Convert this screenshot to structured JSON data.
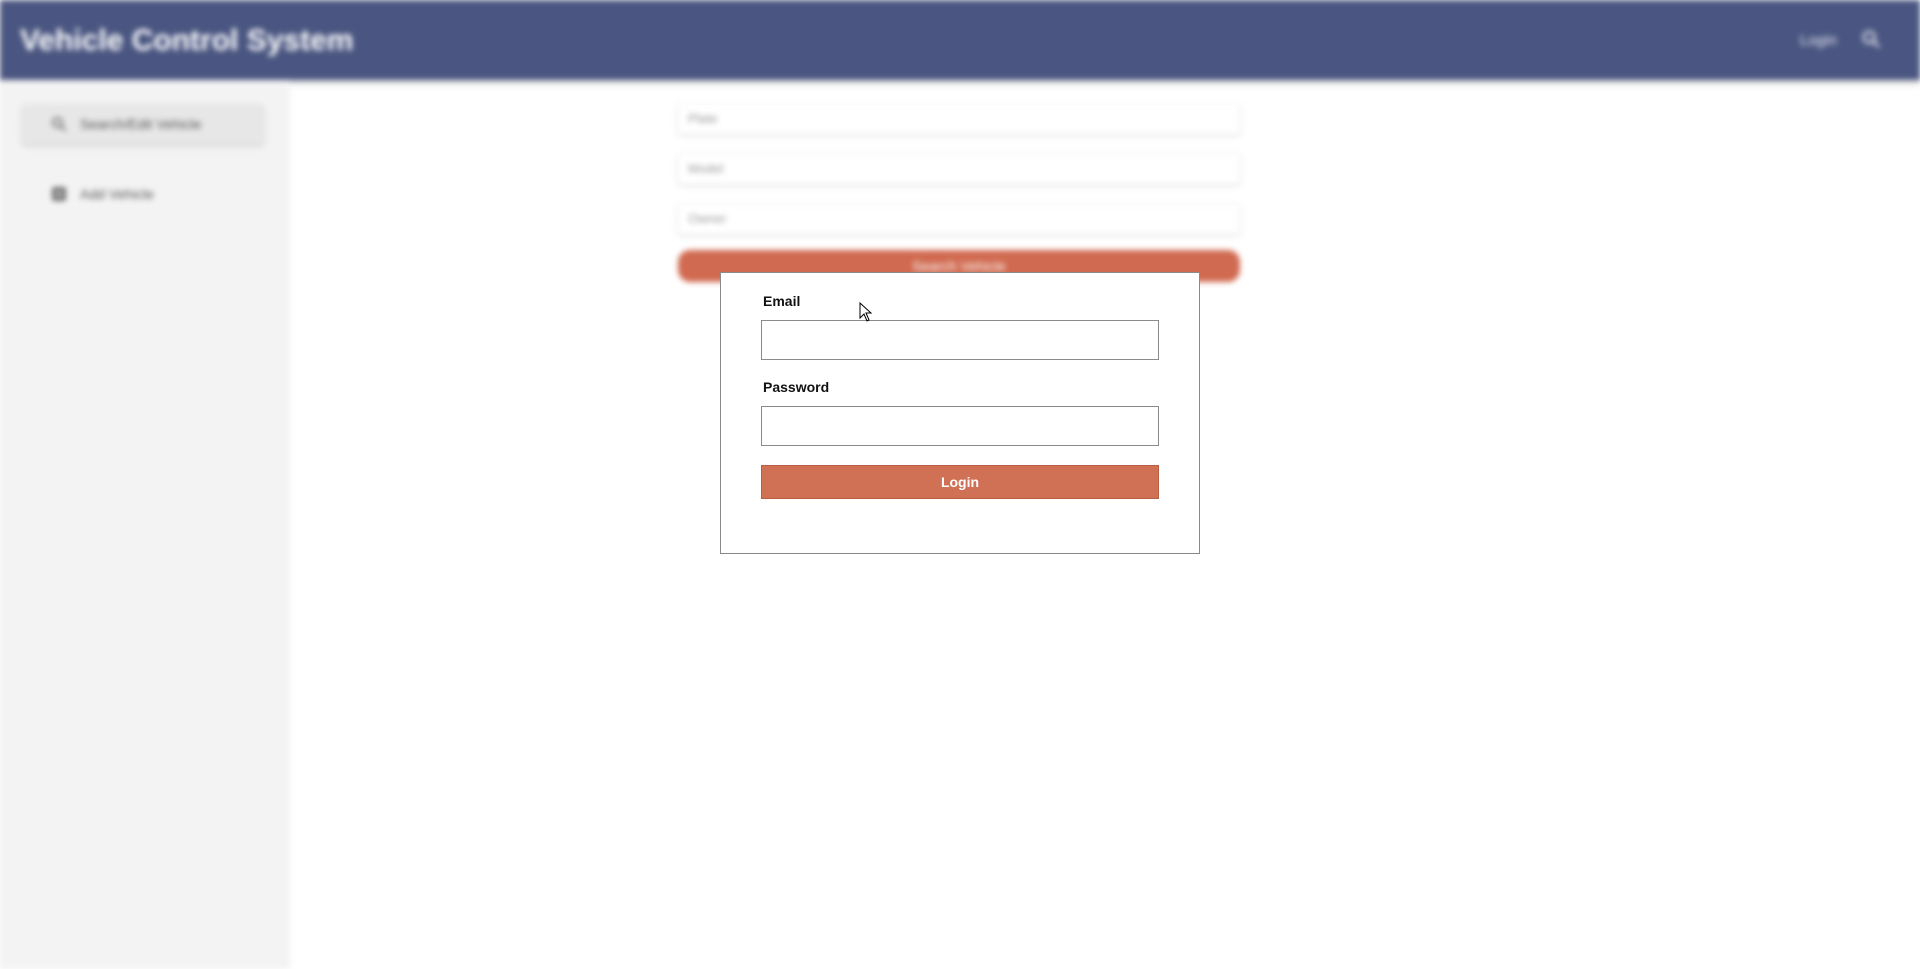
{
  "header": {
    "app_title": "Vehicle Control System",
    "login_link": "Login",
    "search_icon": "search-icon",
    "background_color": "#4a5681"
  },
  "sidebar": {
    "items": [
      {
        "label": "Search/Edit Vehicle",
        "icon": "search-icon",
        "active": true
      },
      {
        "label": "Add Vehicle",
        "icon": "add-box-icon",
        "active": false
      }
    ]
  },
  "search_form": {
    "fields": [
      {
        "placeholder": "Plate"
      },
      {
        "placeholder": "Model"
      },
      {
        "placeholder": "Owner"
      }
    ],
    "button_label": "Search Vehicle"
  },
  "login_modal": {
    "email_label": "Email",
    "email_value": "",
    "password_label": "Password",
    "password_value": "",
    "login_button": "Login",
    "accent_color": "#d07055"
  }
}
